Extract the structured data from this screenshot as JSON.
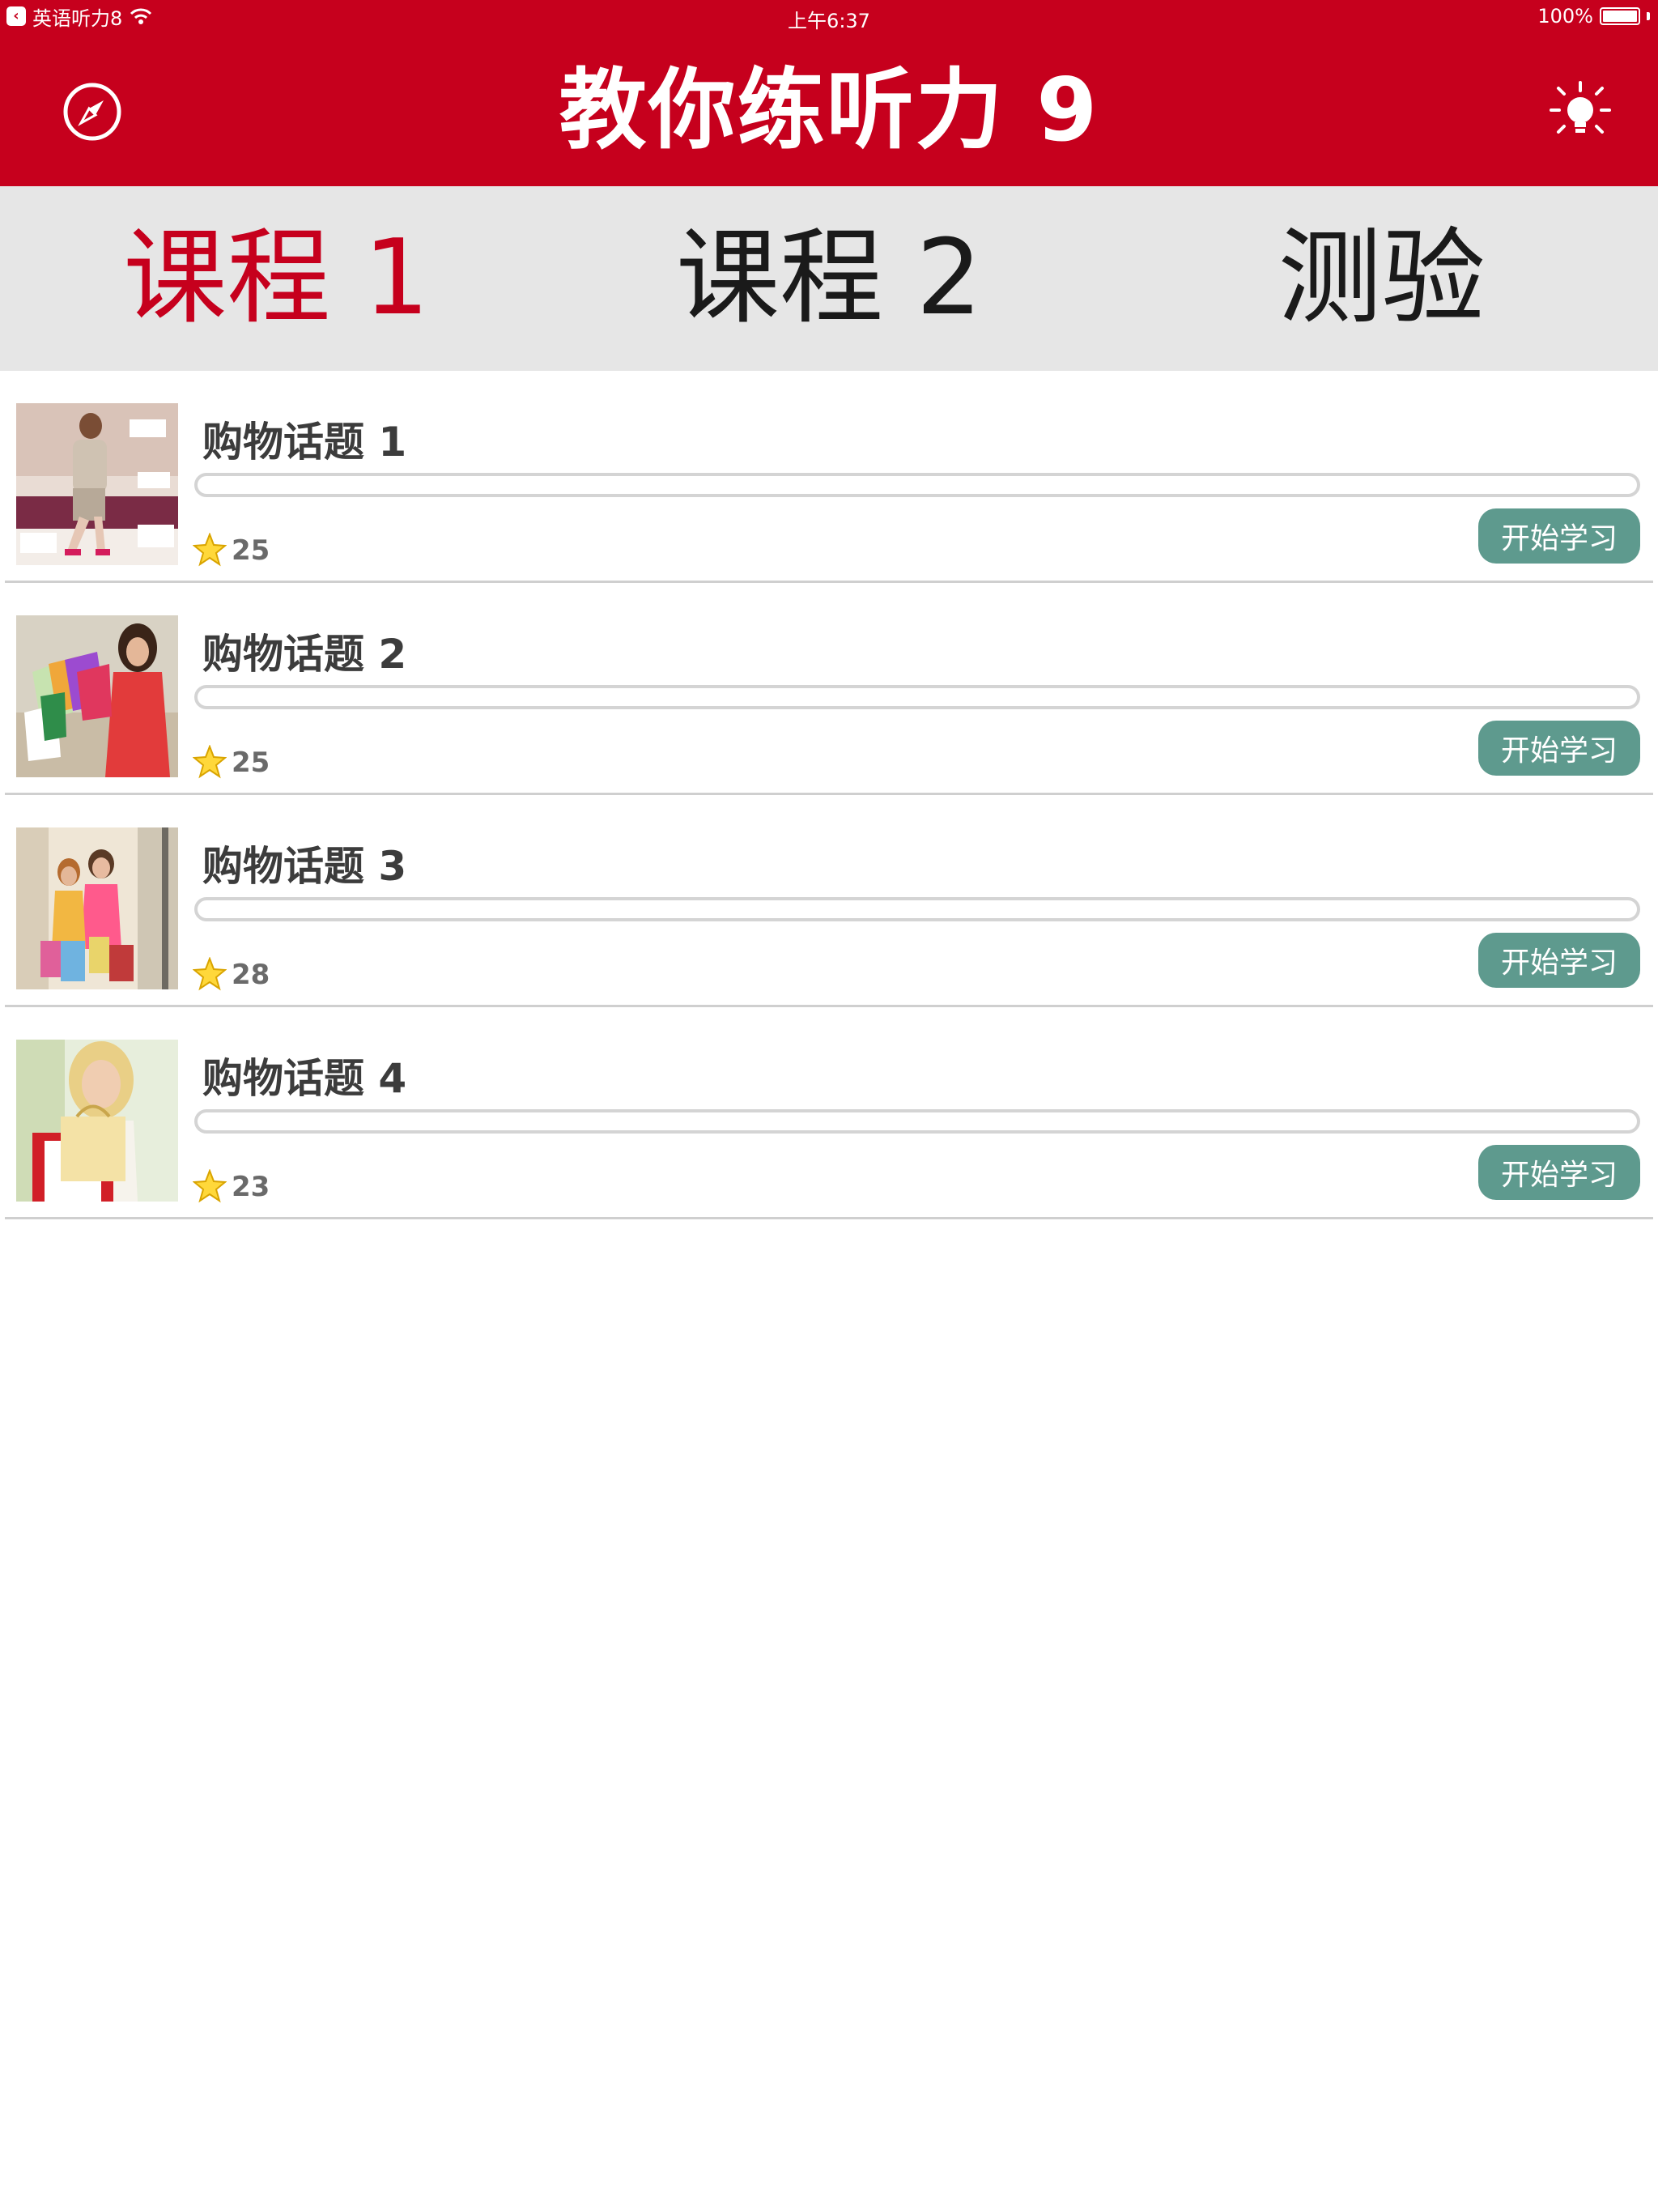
{
  "status_bar": {
    "back_app": "英语听力8",
    "time": "上午6:37",
    "battery_text": "100%",
    "battery_level": 1.0
  },
  "nav": {
    "title": "教你练听力 9",
    "left_icon": "compass-icon",
    "right_icon": "lightbulb-icon"
  },
  "tabs": [
    {
      "label": "课程 1",
      "active": true
    },
    {
      "label": "课程 2",
      "active": false
    },
    {
      "label": "测验",
      "active": false
    }
  ],
  "lessons": [
    {
      "title": "购物话题 1",
      "count": "25",
      "button": "开始学习",
      "progress": 0,
      "image": "woman-trying-shoes-photo"
    },
    {
      "title": "购物话题 2",
      "count": "25",
      "button": "开始学习",
      "progress": 0,
      "image": "woman-with-shopping-bags-photo"
    },
    {
      "title": "购物话题 3",
      "count": "28",
      "button": "开始学习",
      "progress": 0,
      "image": "two-women-shopping-photo"
    },
    {
      "title": "购物话题 4",
      "count": "23",
      "button": "开始学习",
      "progress": 0,
      "image": "blonde-woman-shopping-bag-photo"
    }
  ],
  "colors": {
    "brand_red": "#c6001d",
    "button_teal": "#5e9a8e",
    "tab_bar_bg": "#e6e6e6"
  }
}
